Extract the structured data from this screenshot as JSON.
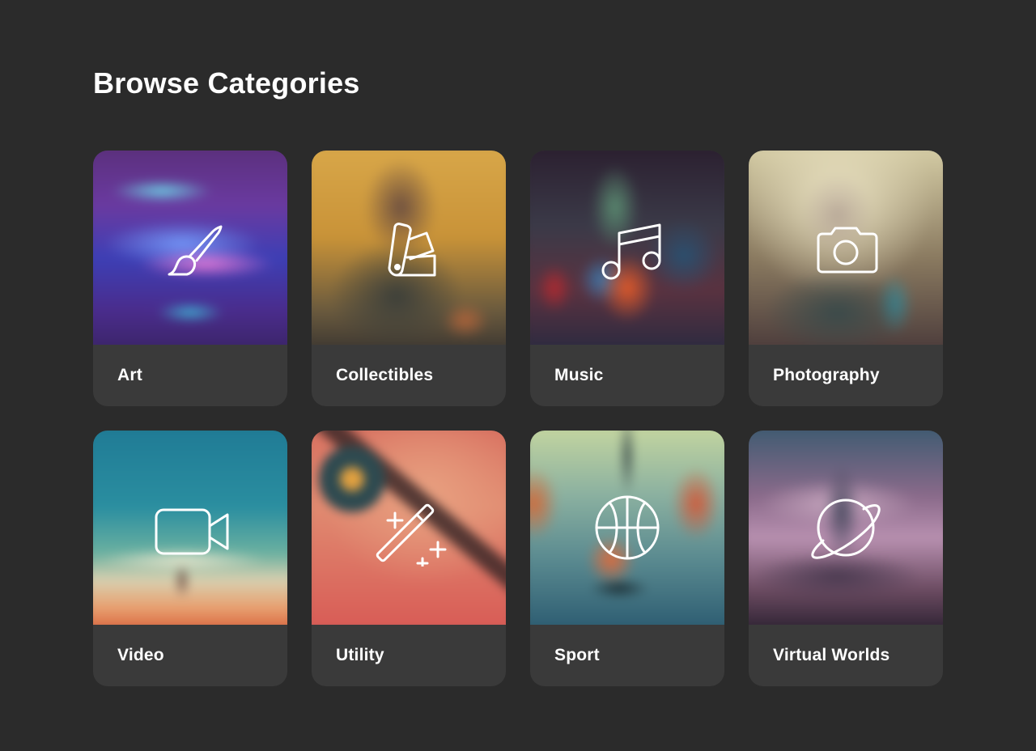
{
  "page": {
    "title": "Browse Categories"
  },
  "categories": [
    {
      "label": "Art",
      "icon": "paintbrush-icon"
    },
    {
      "label": "Collectibles",
      "icon": "color-swatch-icon"
    },
    {
      "label": "Music",
      "icon": "music-note-icon"
    },
    {
      "label": "Photography",
      "icon": "camera-icon"
    },
    {
      "label": "Video",
      "icon": "video-camera-icon"
    },
    {
      "label": "Utility",
      "icon": "magic-wand-icon"
    },
    {
      "label": "Sport",
      "icon": "basketball-icon"
    },
    {
      "label": "Virtual Worlds",
      "icon": "planet-icon"
    }
  ],
  "colors": {
    "background": "#2b2b2b",
    "card": "#3a3a3a",
    "text": "#ffffff"
  }
}
